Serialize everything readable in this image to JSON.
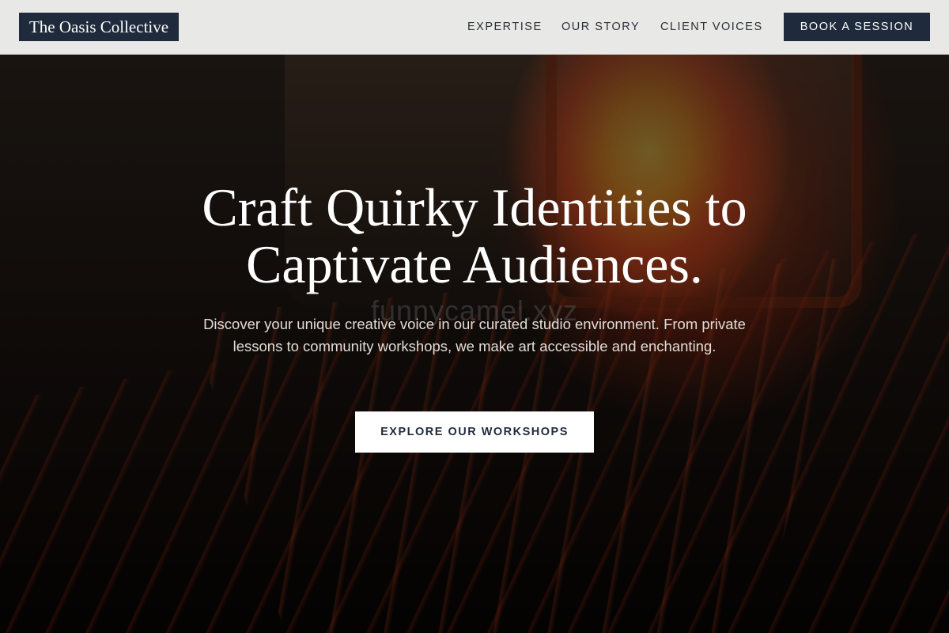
{
  "header": {
    "logo": "The Oasis Collective",
    "nav": [
      {
        "label": "EXPERTISE"
      },
      {
        "label": "OUR STORY"
      },
      {
        "label": "CLIENT VOICES"
      }
    ],
    "cta_label": "BOOK A SESSION"
  },
  "hero": {
    "headline": "Craft Quirky Identities to Captivate Audiences.",
    "subtext": "Discover your unique creative voice in our curated studio environment. From private lessons to community workshops, we make art accessible and enchanting.",
    "cta_label": "EXPLORE OUR WORKSHOPS",
    "watermark": "funnycamel.xyz"
  },
  "colors": {
    "header_bg": "#e8e8e7",
    "navy": "#1f2a3c",
    "white": "#ffffff"
  }
}
